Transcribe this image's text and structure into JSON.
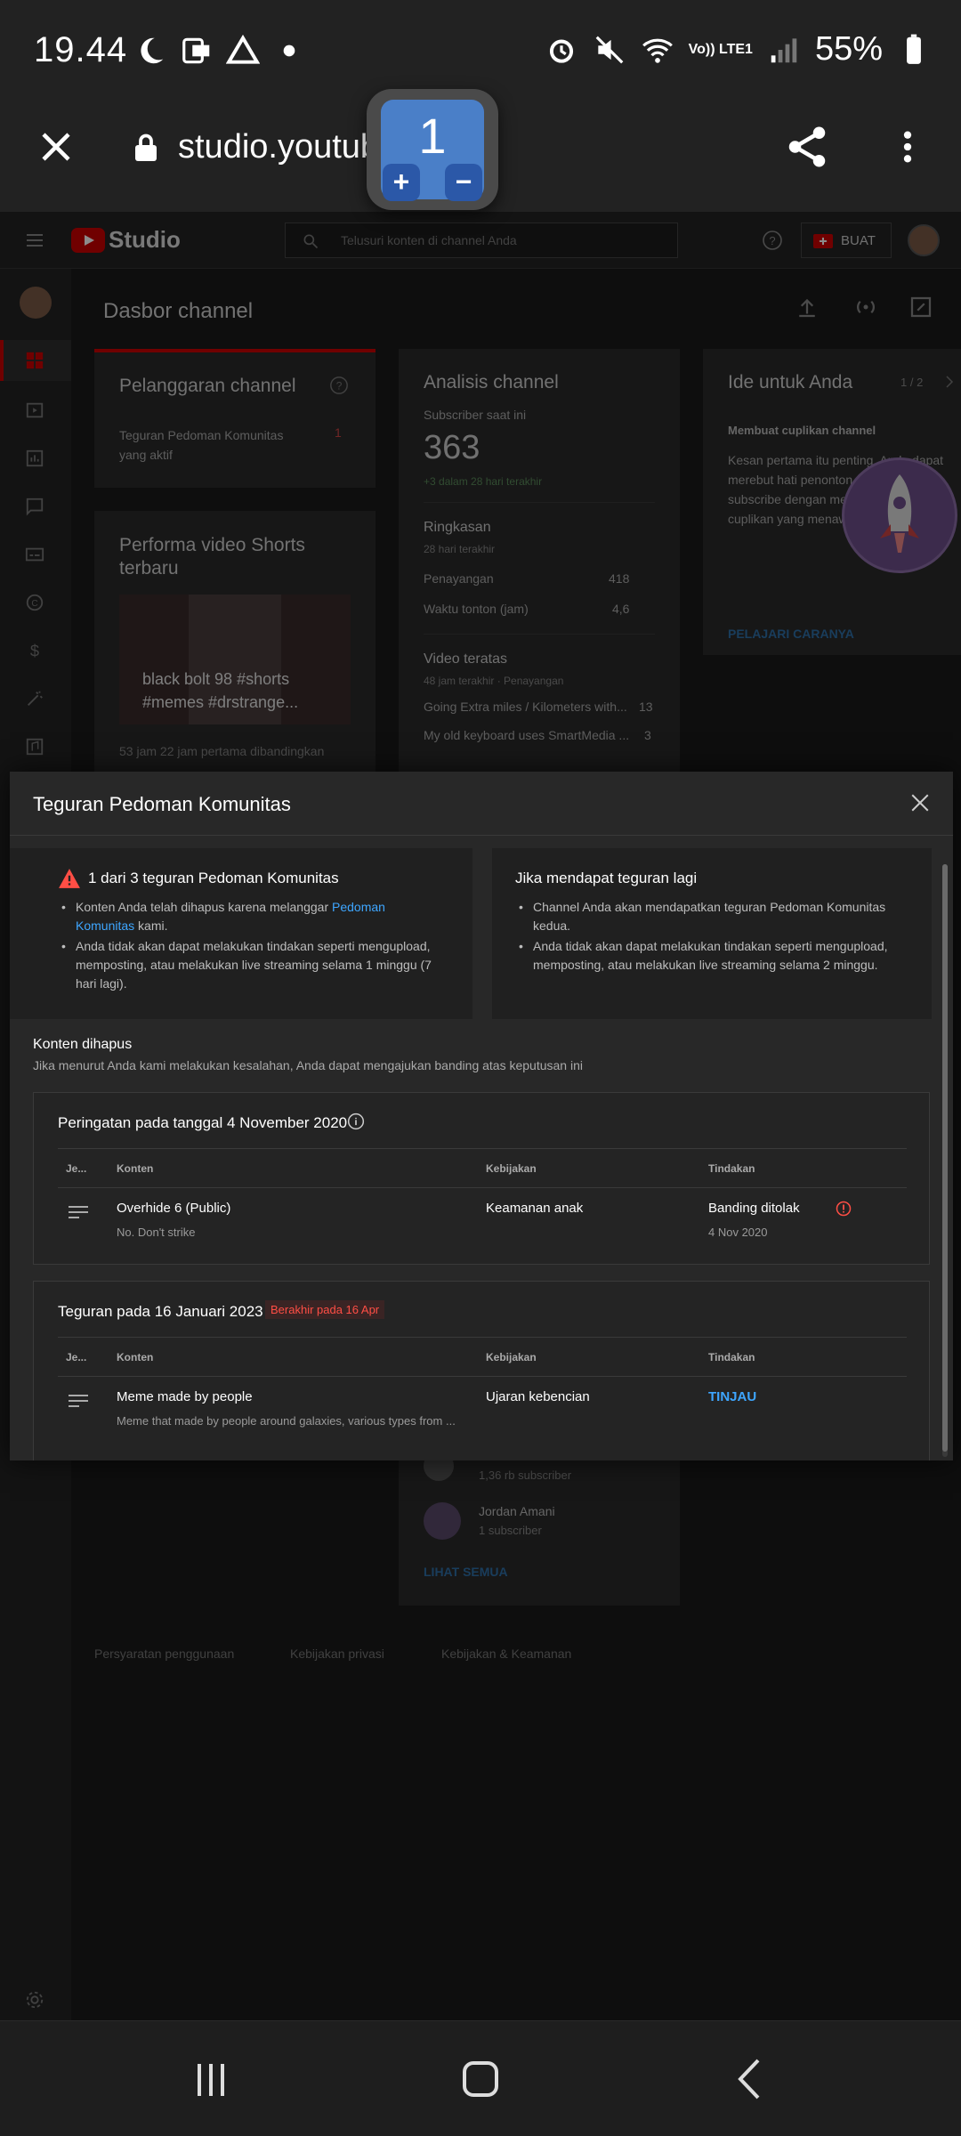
{
  "status_bar": {
    "time": "19.44",
    "network": "Vo)) LTE1",
    "battery": "55%"
  },
  "browser": {
    "url": "studio.youtub",
    "zoom_level": "1"
  },
  "studio_background": {
    "logo_text": "Studio",
    "search_placeholder": "Telusuri konten di channel Anda",
    "create_button": "BUAT",
    "page_title": "Dasbor channel",
    "card_violations_title": "Pelanggaran channel",
    "card_violations_item": "Teguran Pedoman Komunitas yang aktif",
    "card_violations_count": "1",
    "card_shorts_title": "Performa video Shorts terbaru",
    "card_shorts_thumb_text": "black bolt 98 #shorts #memes #drstrange...",
    "card_shorts_caption": "53 jam 22 jam pertama dibandingkan",
    "card_analytics_title": "Analisis channel",
    "card_analytics_subs_label": "Subscriber saat ini",
    "card_analytics_subs_value": "363",
    "card_analytics_subs_delta": "+3 dalam 28 hari terakhir",
    "card_analytics_summary": "Ringkasan",
    "card_analytics_period": "28 hari terakhir",
    "card_analytics_views_label": "Penayangan",
    "card_analytics_views_value": "418",
    "card_analytics_watch_label": "Waktu tonton (jam)",
    "card_analytics_watch_value": "4,6",
    "card_analytics_top": "Video teratas",
    "card_analytics_top_period": "48 jam terakhir · Penayangan",
    "top_video_1": "Going Extra miles / Kilometers with...",
    "top_video_1_views": "13",
    "top_video_2": "My old keyboard uses SmartMedia ...",
    "top_video_2_views": "3",
    "card_ideas_title": "Ide untuk Anda",
    "card_ideas_pager": "1 / 2",
    "card_ideas_subtitle": "Membuat cuplikan channel",
    "card_ideas_body": "Kesan pertama itu penting. Anda dapat merebut hati penonton yang belum subscribe dengan menampilkan cuplikan yang menawan",
    "card_ideas_link": "PELAJARI CARANYA",
    "subscriber_1_count": "1,36 rb subscriber",
    "subscriber_2_name": "Jordan Amani",
    "subscriber_2_count": "1 subscriber",
    "see_all": "LIHAT SEMUA",
    "footer_terms": "Persyaratan penggunaan",
    "footer_privacy": "Kebijakan privasi",
    "footer_safety": "Kebijakan & Keamanan"
  },
  "modal": {
    "title": "Teguran Pedoman Komunitas",
    "strike_panel": {
      "title": "1 dari 3 teguran Pedoman Komunitas",
      "bullet1_pre": "Konten Anda telah dihapus karena melanggar ",
      "bullet1_link": "Pedoman Komunitas",
      "bullet1_post": " kami.",
      "bullet2": "Anda tidak akan dapat melakukan tindakan seperti mengupload, memposting, atau melakukan live streaming selama 1 minggu (7 hari lagi)."
    },
    "next_panel": {
      "title": "Jika mendapat teguran lagi",
      "bullet1": "Channel Anda akan mendapatkan teguran Pedoman Komunitas kedua.",
      "bullet2": "Anda tidak akan dapat melakukan tindakan seperti mengupload, memposting, atau melakukan live streaming selama 2 minggu."
    },
    "removed_title": "Konten dihapus",
    "removed_subtitle": "Jika menurut Anda kami melakukan kesalahan, Anda dapat mengajukan banding atas keputusan ini",
    "columns": {
      "type": "Je...",
      "content": "Konten",
      "policy": "Kebijakan",
      "action": "Tindakan"
    },
    "warning_box": {
      "title": "Peringatan pada tanggal 4 November 2020",
      "row": {
        "video_title": "Overhide 6 (Public)",
        "video_desc": "No. Don't strike",
        "policy": "Keamanan anak",
        "action": "Banding ditolak",
        "action_date": "4 Nov 2020"
      }
    },
    "strike_box": {
      "title": "Teguran pada 16 Januari 2023",
      "expires": "Berakhir pada 16 Apr",
      "row": {
        "video_title": "Meme made by people",
        "video_desc": "Meme that made by people around galaxies, various types from ...",
        "policy": "Ujaran kebencian",
        "action": "TINJAU"
      }
    }
  },
  "colors": {
    "accent_link": "#3ea6ff",
    "warning_red": "#ff4e45",
    "youtube_red": "#ff0000"
  }
}
